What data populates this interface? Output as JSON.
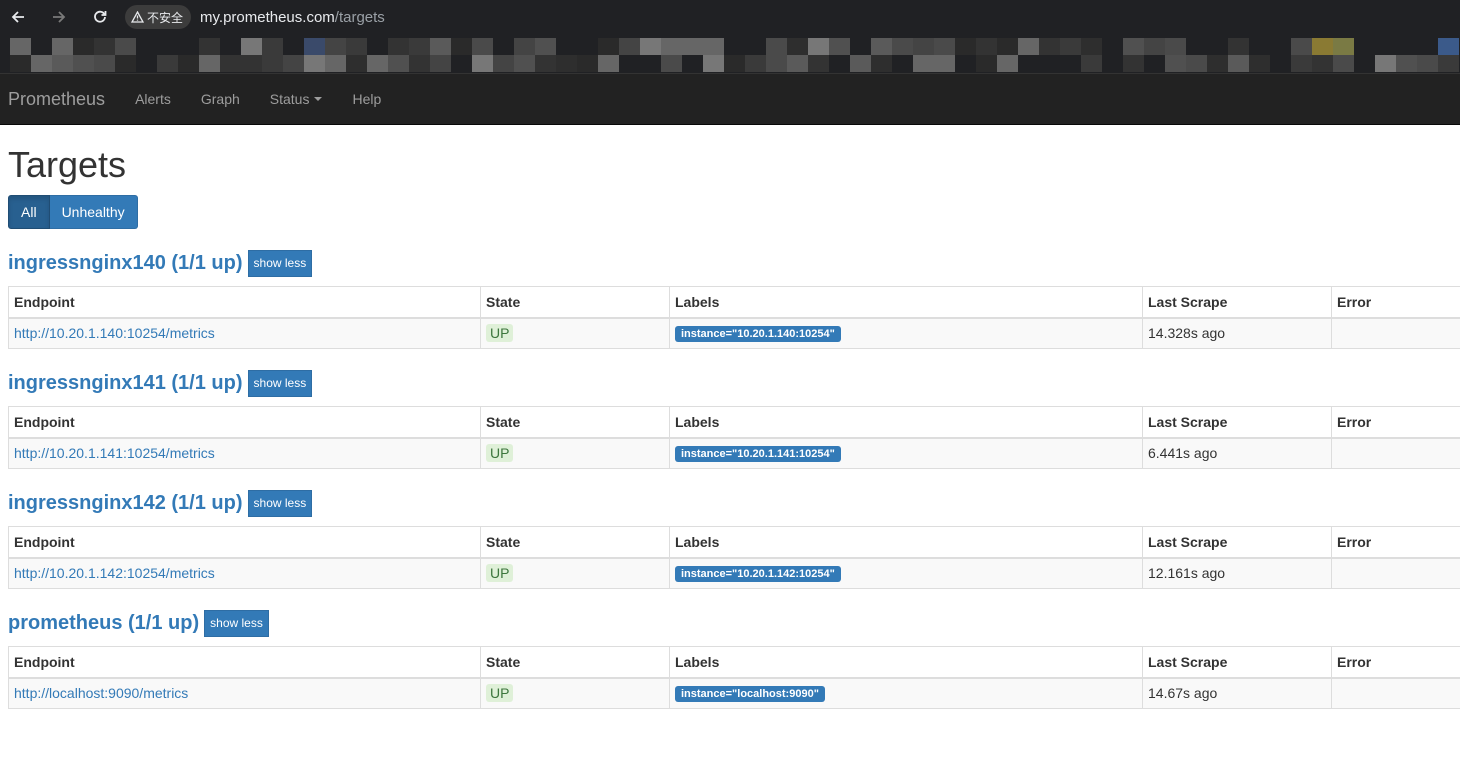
{
  "browser": {
    "security_label": "不安全",
    "url_host": "my.prometheus.com",
    "url_path": "/targets"
  },
  "navbar": {
    "brand": "Prometheus",
    "items": [
      {
        "label": "Alerts"
      },
      {
        "label": "Graph"
      },
      {
        "label": "Status"
      },
      {
        "label": "Help"
      }
    ]
  },
  "page": {
    "title": "Targets",
    "filters": {
      "all": "All",
      "unhealthy": "Unhealthy"
    }
  },
  "table_headers": {
    "endpoint": "Endpoint",
    "state": "State",
    "labels": "Labels",
    "last_scrape": "Last Scrape",
    "error": "Error"
  },
  "show_less_label": "show less",
  "jobs": [
    {
      "title": "ingressnginx140 (1/1 up)",
      "endpoint": "http://10.20.1.140:10254/metrics",
      "state": "UP",
      "label": "instance=\"10.20.1.140:10254\"",
      "last_scrape": "14.328s ago",
      "error": ""
    },
    {
      "title": "ingressnginx141 (1/1 up)",
      "endpoint": "http://10.20.1.141:10254/metrics",
      "state": "UP",
      "label": "instance=\"10.20.1.141:10254\"",
      "last_scrape": "6.441s ago",
      "error": ""
    },
    {
      "title": "ingressnginx142 (1/1 up)",
      "endpoint": "http://10.20.1.142:10254/metrics",
      "state": "UP",
      "label": "instance=\"10.20.1.142:10254\"",
      "last_scrape": "12.161s ago",
      "error": ""
    },
    {
      "title": "prometheus (1/1 up)",
      "endpoint": "http://localhost:9090/metrics",
      "state": "UP",
      "label": "instance=\"localhost:9090\"",
      "last_scrape": "14.67s ago",
      "error": ""
    }
  ],
  "colors": {
    "primary": "#337ab7",
    "navbar_bg": "#222222",
    "state_up_bg": "#dff0d8",
    "state_up_text": "#3c763d"
  }
}
